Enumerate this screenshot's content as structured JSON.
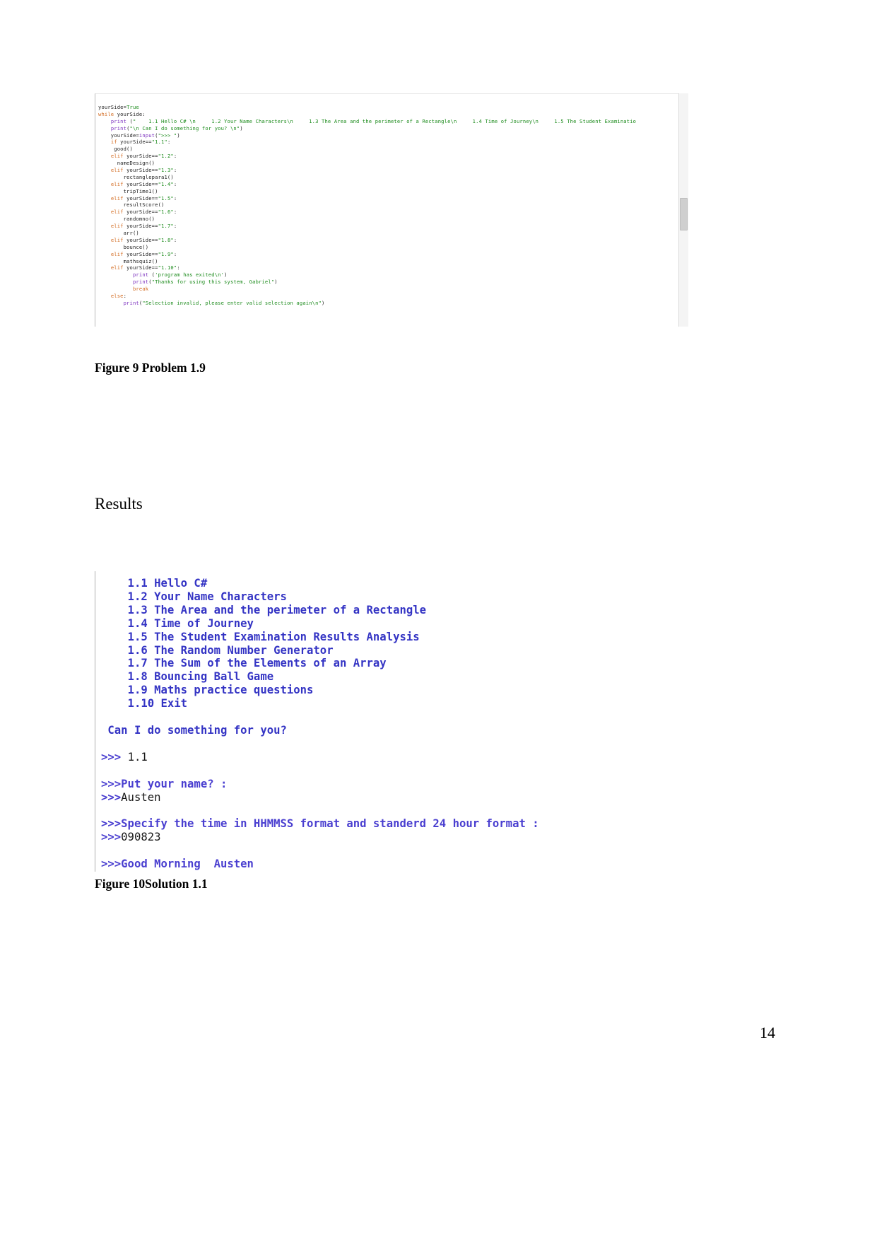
{
  "page": {
    "number": "14"
  },
  "figure9": {
    "caption": "Figure 9 Problem 1.9",
    "code_lines": [
      [
        {
          "t": "yourSide=",
          "c": "tk-pl"
        },
        {
          "t": "True",
          "c": "tk-cls"
        }
      ],
      [
        {
          "t": "while",
          "c": "tk-kw"
        },
        {
          "t": " yourSide:",
          "c": "tk-pl"
        }
      ],
      [
        {
          "t": "    ",
          "c": "tk-pl"
        },
        {
          "t": "print",
          "c": "tk-fn"
        },
        {
          "t": " (",
          "c": "tk-pl"
        },
        {
          "t": "\"    1.1 Hello C# \\n     1.2 Your Name Characters\\n     1.3 The Area and the perimeter of a Rectangle\\n     1.4 Time of Journey\\n     1.5 The Student Examinatio",
          "c": "tk-str"
        }
      ],
      [
        {
          "t": "    ",
          "c": "tk-pl"
        },
        {
          "t": "print",
          "c": "tk-fn"
        },
        {
          "t": "(",
          "c": "tk-pl"
        },
        {
          "t": "\"\\n Can I do something for you? \\n\"",
          "c": "tk-str"
        },
        {
          "t": ")",
          "c": "tk-pl"
        }
      ],
      [
        {
          "t": "    yourSide=",
          "c": "tk-pl"
        },
        {
          "t": "input",
          "c": "tk-fn"
        },
        {
          "t": "(",
          "c": "tk-pl"
        },
        {
          "t": "\">>> \"",
          "c": "tk-str"
        },
        {
          "t": ")",
          "c": "tk-pl"
        }
      ],
      [
        {
          "t": "    ",
          "c": "tk-pl"
        },
        {
          "t": "if",
          "c": "tk-kw"
        },
        {
          "t": " yourSide==",
          "c": "tk-pl"
        },
        {
          "t": "\"1.1\"",
          "c": "tk-str"
        },
        {
          "t": ":",
          "c": "tk-pl"
        }
      ],
      [
        {
          "t": "     good()",
          "c": "tk-pl"
        }
      ],
      [
        {
          "t": "    ",
          "c": "tk-pl"
        },
        {
          "t": "elif",
          "c": "tk-kw"
        },
        {
          "t": " yourSide==",
          "c": "tk-pl"
        },
        {
          "t": "\"1.2\"",
          "c": "tk-str"
        },
        {
          "t": ":",
          "c": "tk-pl"
        }
      ],
      [
        {
          "t": "      nameDesign()",
          "c": "tk-pl"
        }
      ],
      [
        {
          "t": "    ",
          "c": "tk-pl"
        },
        {
          "t": "elif",
          "c": "tk-kw"
        },
        {
          "t": " yourSide==",
          "c": "tk-pl"
        },
        {
          "t": "\"1.3\"",
          "c": "tk-str"
        },
        {
          "t": ":",
          "c": "tk-pl"
        }
      ],
      [
        {
          "t": "        rectanglepara1()",
          "c": "tk-pl"
        }
      ],
      [
        {
          "t": "    ",
          "c": "tk-pl"
        },
        {
          "t": "elif",
          "c": "tk-kw"
        },
        {
          "t": " yourSide==",
          "c": "tk-pl"
        },
        {
          "t": "\"1.4\"",
          "c": "tk-str"
        },
        {
          "t": ":",
          "c": "tk-pl"
        }
      ],
      [
        {
          "t": "        tripTime1()",
          "c": "tk-pl"
        }
      ],
      [
        {
          "t": "    ",
          "c": "tk-pl"
        },
        {
          "t": "elif",
          "c": "tk-kw"
        },
        {
          "t": " yourSide==",
          "c": "tk-pl"
        },
        {
          "t": "\"1.5\"",
          "c": "tk-str"
        },
        {
          "t": ":",
          "c": "tk-pl"
        }
      ],
      [
        {
          "t": "        resultScore()",
          "c": "tk-pl"
        }
      ],
      [
        {
          "t": "    ",
          "c": "tk-pl"
        },
        {
          "t": "elif",
          "c": "tk-kw"
        },
        {
          "t": " yourSide==",
          "c": "tk-pl"
        },
        {
          "t": "\"1.6\"",
          "c": "tk-str"
        },
        {
          "t": ":",
          "c": "tk-pl"
        }
      ],
      [
        {
          "t": "        randomno()",
          "c": "tk-pl"
        }
      ],
      [
        {
          "t": "    ",
          "c": "tk-pl"
        },
        {
          "t": "elif",
          "c": "tk-kw"
        },
        {
          "t": " yourSide==",
          "c": "tk-pl"
        },
        {
          "t": "\"1.7\"",
          "c": "tk-str"
        },
        {
          "t": ":",
          "c": "tk-pl"
        }
      ],
      [
        {
          "t": "        arr()",
          "c": "tk-pl"
        }
      ],
      [
        {
          "t": "    ",
          "c": "tk-pl"
        },
        {
          "t": "elif",
          "c": "tk-kw"
        },
        {
          "t": " yourSide==",
          "c": "tk-pl"
        },
        {
          "t": "\"1.8\"",
          "c": "tk-str"
        },
        {
          "t": ":",
          "c": "tk-pl"
        }
      ],
      [
        {
          "t": "        bounce()",
          "c": "tk-pl"
        }
      ],
      [
        {
          "t": "    ",
          "c": "tk-pl"
        },
        {
          "t": "elif",
          "c": "tk-kw"
        },
        {
          "t": " yourSide==",
          "c": "tk-pl"
        },
        {
          "t": "\"1.9\"",
          "c": "tk-str"
        },
        {
          "t": ":",
          "c": "tk-pl"
        }
      ],
      [
        {
          "t": "        mathsquiz()",
          "c": "tk-pl"
        }
      ],
      [
        {
          "t": "    ",
          "c": "tk-pl"
        },
        {
          "t": "elif",
          "c": "tk-kw"
        },
        {
          "t": " yourSide==",
          "c": "tk-pl"
        },
        {
          "t": "\"1.10\"",
          "c": "tk-str"
        },
        {
          "t": ":",
          "c": "tk-pl"
        }
      ],
      [
        {
          "t": "           ",
          "c": "tk-pl"
        },
        {
          "t": "print",
          "c": "tk-fn"
        },
        {
          "t": " (",
          "c": "tk-pl"
        },
        {
          "t": "'program has exited\\n'",
          "c": "tk-str"
        },
        {
          "t": ")",
          "c": "tk-pl"
        }
      ],
      [
        {
          "t": "           ",
          "c": "tk-pl"
        },
        {
          "t": "print",
          "c": "tk-fn"
        },
        {
          "t": "(",
          "c": "tk-pl"
        },
        {
          "t": "\"Thanks for using this system, Gabriel\"",
          "c": "tk-str"
        },
        {
          "t": ")",
          "c": "tk-pl"
        }
      ],
      [
        {
          "t": "           ",
          "c": "tk-pl"
        },
        {
          "t": "break",
          "c": "tk-kw"
        }
      ],
      [
        {
          "t": "    ",
          "c": "tk-pl"
        },
        {
          "t": "else",
          "c": "tk-kw"
        },
        {
          "t": ":",
          "c": "tk-pl"
        }
      ],
      [
        {
          "t": "        ",
          "c": "tk-pl"
        },
        {
          "t": "print",
          "c": "tk-fn"
        },
        {
          "t": "(",
          "c": "tk-pl"
        },
        {
          "t": "\"Selection invalid, please enter valid selection again\\n\"",
          "c": "tk-str"
        },
        {
          "t": ")",
          "c": "tk-pl"
        }
      ]
    ]
  },
  "results": {
    "heading": "Results"
  },
  "figure10": {
    "caption": "Figure 10Solution 1.1",
    "output_lines": [
      [
        {
          "t": "    1.1 Hello C#",
          "c": "c-menu"
        }
      ],
      [
        {
          "t": "    1.2 Your Name Characters",
          "c": "c-menu"
        }
      ],
      [
        {
          "t": "    1.3 The Area and the perimeter of a Rectangle",
          "c": "c-menu"
        }
      ],
      [
        {
          "t": "    1.4 Time of Journey",
          "c": "c-menu"
        }
      ],
      [
        {
          "t": "    1.5 The Student Examination Results Analysis",
          "c": "c-menu"
        }
      ],
      [
        {
          "t": "    1.6 The Random Number Generator",
          "c": "c-menu"
        }
      ],
      [
        {
          "t": "    1.7 The Sum of the Elements of an Array",
          "c": "c-menu"
        }
      ],
      [
        {
          "t": "    1.8 Bouncing Ball Game",
          "c": "c-menu"
        }
      ],
      [
        {
          "t": "    1.9 Maths practice questions",
          "c": "c-menu"
        }
      ],
      [
        {
          "t": "    1.10 Exit",
          "c": "c-menu"
        }
      ],
      [
        {
          "t": "",
          "c": "c-plain"
        }
      ],
      [
        {
          "t": " Can I do something for you?",
          "c": "c-plain"
        }
      ],
      [
        {
          "t": "",
          "c": "c-plain"
        }
      ],
      [
        {
          "t": ">>> ",
          "c": "c-prompt"
        },
        {
          "t": "1.1",
          "c": "c-input"
        }
      ],
      [
        {
          "t": "",
          "c": "c-plain"
        }
      ],
      [
        {
          "t": ">>>Put your name? :",
          "c": "c-prompt"
        }
      ],
      [
        {
          "t": ">>>",
          "c": "c-prompt"
        },
        {
          "t": "Austen",
          "c": "c-input"
        }
      ],
      [
        {
          "t": "",
          "c": "c-plain"
        }
      ],
      [
        {
          "t": ">>>Specify the time in HHMMSS format and standerd 24 hour format :",
          "c": "c-prompt"
        }
      ],
      [
        {
          "t": ">>>",
          "c": "c-prompt"
        },
        {
          "t": "090823",
          "c": "c-input"
        }
      ],
      [
        {
          "t": "",
          "c": "c-plain"
        }
      ],
      [
        {
          "t": ">>>Good Morning  Austen",
          "c": "c-prompt"
        }
      ]
    ]
  }
}
